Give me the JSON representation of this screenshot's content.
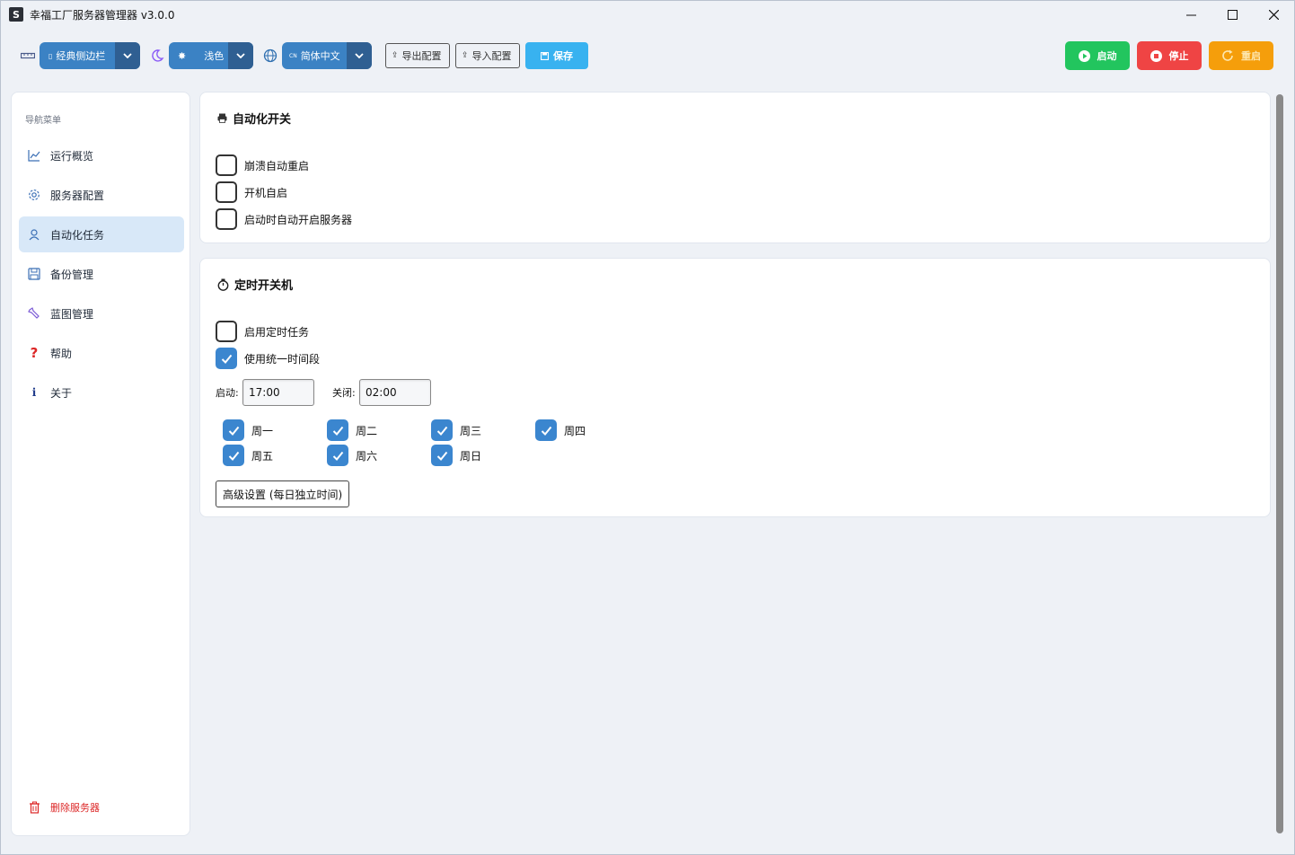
{
  "window": {
    "title": "幸福工厂服务器管理器 v3.0.0",
    "app_icon_glyph": "S"
  },
  "toolbar": {
    "layout_select": "经典侧边栏",
    "theme_select": "浅色",
    "language_select": "简体中文",
    "language_badge": "CN",
    "export_label": "导出配置",
    "import_label": "导入配置",
    "save_label": "保存",
    "start_label": "启动",
    "stop_label": "停止",
    "restart_label": "重启"
  },
  "sidebar": {
    "heading": "导航菜单",
    "items": [
      {
        "label": "运行概览",
        "icon": "chart-line-icon"
      },
      {
        "label": "服务器配置",
        "icon": "gear-icon"
      },
      {
        "label": "自动化任务",
        "icon": "robot-icon",
        "active": true
      },
      {
        "label": "备份管理",
        "icon": "floppy-disk-icon"
      },
      {
        "label": "蓝图管理",
        "icon": "wrench-icon"
      },
      {
        "label": "帮助",
        "icon": "question-mark-icon"
      },
      {
        "label": "关于",
        "icon": "info-icon"
      }
    ],
    "delete_label": "删除服务器"
  },
  "automation": {
    "title": "自动化开关",
    "options": [
      {
        "label": "崩溃自动重启",
        "checked": false
      },
      {
        "label": "开机自启",
        "checked": false
      },
      {
        "label": "启动时自动开启服务器",
        "checked": false
      }
    ]
  },
  "schedule": {
    "title": "定时开关机",
    "enable_label": "启用定时任务",
    "enable_checked": false,
    "unified_label": "使用统一时间段",
    "unified_checked": true,
    "start_label": "启动:",
    "start_value": "17:00",
    "stop_label": "关闭:",
    "stop_value": "02:00",
    "days": [
      {
        "label": "周一",
        "checked": true
      },
      {
        "label": "周二",
        "checked": true
      },
      {
        "label": "周三",
        "checked": true
      },
      {
        "label": "周四",
        "checked": true
      },
      {
        "label": "周五",
        "checked": true
      },
      {
        "label": "周六",
        "checked": true
      },
      {
        "label": "周日",
        "checked": true
      }
    ],
    "advanced_label": "高级设置 (每日独立时间)"
  },
  "colors": {
    "combo_blue": "#3b82c4",
    "save_blue": "#38b2f0",
    "start_green": "#22c55e",
    "stop_red": "#ef4444",
    "restart_orange": "#f59e0b",
    "active_nav": "#d8e8f8",
    "checkbox_on": "#3b86cf"
  }
}
